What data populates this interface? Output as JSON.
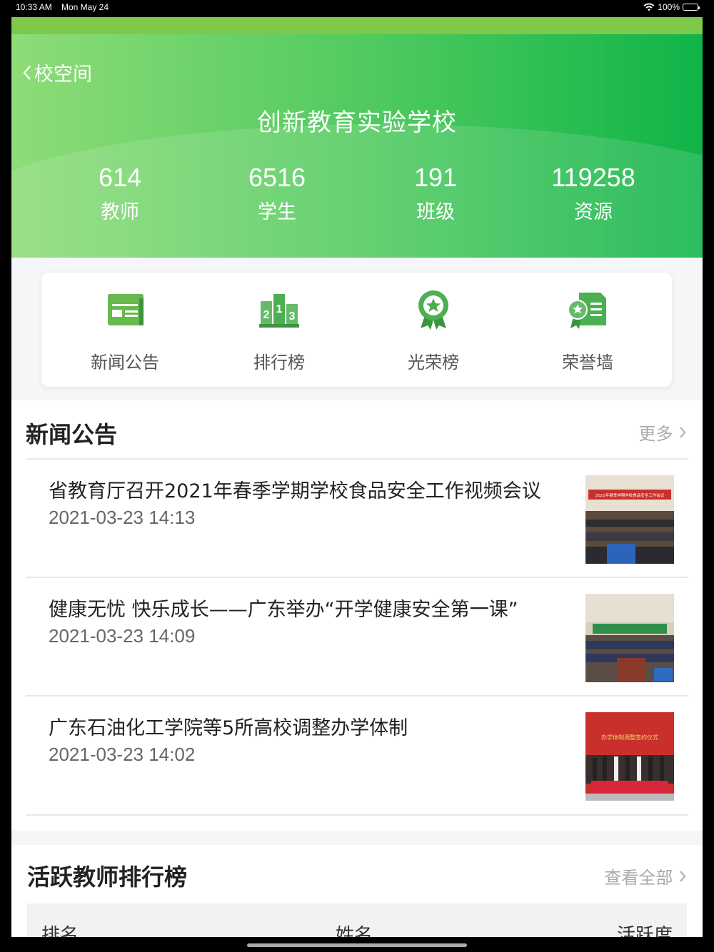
{
  "status_bar": {
    "time": "10:33 AM",
    "date": "Mon May 24",
    "battery": "100%"
  },
  "header": {
    "back_label": "校空间",
    "school_name": "创新教育实验学校",
    "stats": [
      {
        "value": "614",
        "label": "教师"
      },
      {
        "value": "6516",
        "label": "学生"
      },
      {
        "value": "191",
        "label": "班级"
      },
      {
        "value": "119258",
        "label": "资源"
      }
    ]
  },
  "quick_links": [
    {
      "label": "新闻公告",
      "icon": "newspaper-icon"
    },
    {
      "label": "排行榜",
      "icon": "podium-icon"
    },
    {
      "label": "光荣榜",
      "icon": "award-badge-icon"
    },
    {
      "label": "荣誉墙",
      "icon": "certificate-icon"
    }
  ],
  "news_section": {
    "title": "新闻公告",
    "more_label": "更多",
    "items": [
      {
        "title": "省教育厅召开2021年春季学期学校食品安全工作视频会议",
        "time": "2021-03-23 14:13",
        "thumb_caption": "2021年春季学期学校食品安全工作会议"
      },
      {
        "title": "健康无忧 快乐成长——广东举办“开学健康安全第一课”",
        "time": "2021-03-23 14:09"
      },
      {
        "title": "广东石油化工学院等5所高校调整办学体制",
        "time": "2021-03-23 14:02",
        "thumb_caption": "办学体制调整签约仪式"
      }
    ]
  },
  "ranking_section": {
    "title": "活跃教师排行榜",
    "more_label": "查看全部",
    "columns": [
      "排名",
      "姓名",
      "活跃度"
    ]
  },
  "colors": {
    "header_start": "#8edc78",
    "header_end": "#10b449",
    "icon_green": "#4caf50"
  }
}
